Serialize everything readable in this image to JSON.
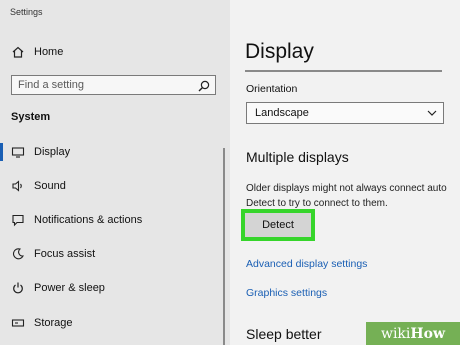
{
  "window": {
    "title": "Settings"
  },
  "sidebar": {
    "home_label": "Home",
    "search_placeholder": "Find a setting",
    "section_label": "System",
    "items": [
      {
        "label": "Display",
        "icon": "monitor-icon",
        "active": true
      },
      {
        "label": "Sound",
        "icon": "speaker-icon"
      },
      {
        "label": "Notifications & actions",
        "icon": "notification-icon"
      },
      {
        "label": "Focus assist",
        "icon": "moon-icon"
      },
      {
        "label": "Power & sleep",
        "icon": "power-icon"
      },
      {
        "label": "Storage",
        "icon": "storage-icon"
      }
    ]
  },
  "main": {
    "title": "Display",
    "orientation_label": "Orientation",
    "orientation_value": "Landscape",
    "multiple_displays_heading": "Multiple displays",
    "multiple_displays_desc": "Older displays might not always connect auto\nDetect to try to connect to them.",
    "detect_button": "Detect",
    "advanced_link": "Advanced display settings",
    "graphics_link": "Graphics settings",
    "sleep_heading": "Sleep better"
  },
  "watermark": {
    "part1": "wiki",
    "part2": "How"
  },
  "colors": {
    "accent": "#1a5fb4",
    "highlight": "#36d52b",
    "watermark": "#6aaa48"
  }
}
